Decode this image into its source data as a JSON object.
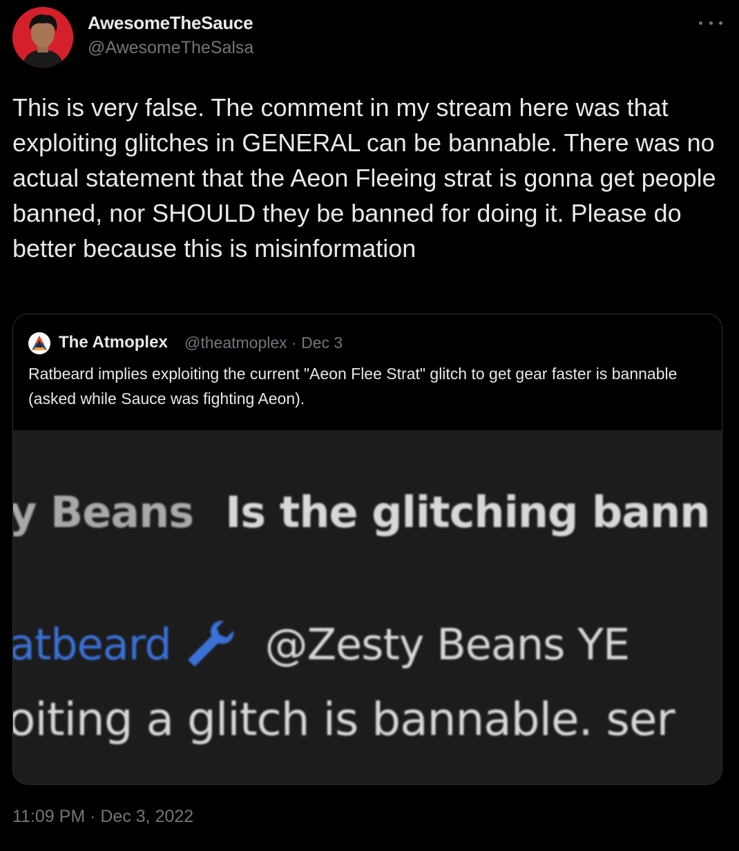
{
  "author": {
    "name": "AwesomeTheSauce",
    "handle": "@AwesomeTheSalsa"
  },
  "tweet": {
    "text": "This is very false. The comment in my stream here was that exploiting glitches in GENERAL can be bannable. There was no actual statement that the Aeon Fleeing strat is gonna get people banned, nor SHOULD they be banned for doing it. Please do better because this is misinformation",
    "timestamp": "11:09 PM · Dec 3, 2022"
  },
  "quoted": {
    "name": "The Atmoplex",
    "handle_date": "@theatmoplex · Dec 3",
    "text": "Ratbeard implies exploiting the current \"Aeon Flee Strat\" glitch to get gear faster is bannable (asked while Sauce was fighting Aeon).",
    "image": {
      "line1_user": "y Beans",
      "line1_msg": "Is the glitching bann",
      "line2_user": "atbeard",
      "line2_msg": "@Zesty Beans YE",
      "line3": "oiting a glitch is bannable. ser"
    }
  },
  "icons": {
    "more": "more-dots-icon",
    "wrench": "wrench-icon",
    "logo": "atmoplex-logo-icon"
  },
  "colors": {
    "background": "#000000",
    "text": "#e7e9ea",
    "secondary": "#71767b",
    "border": "#2f3336",
    "mod_blue": "#3a72d8"
  }
}
